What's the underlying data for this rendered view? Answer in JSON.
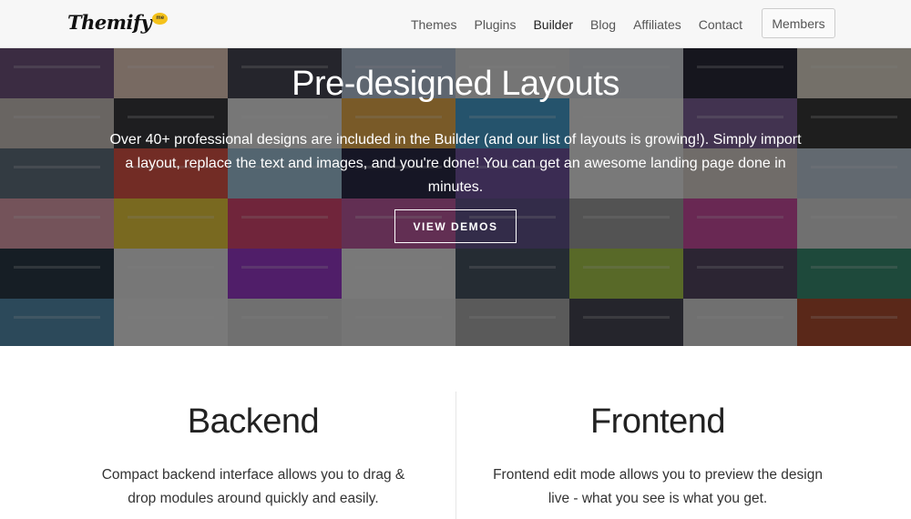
{
  "header": {
    "logo_text": "Themify",
    "logo_badge": "me",
    "nav": [
      "Themes",
      "Plugins",
      "Builder",
      "Blog",
      "Affiliates",
      "Contact"
    ],
    "active_nav": "Builder",
    "members_label": "Members"
  },
  "hero": {
    "title": "Pre-designed Layouts",
    "description": "Over 40+ professional designs are included in the Builder (and our list of layouts is growing!). Simply import a layout, replace the text and images, and you're done! You can get an awesome landing page done in minutes.",
    "button_label": "VIEW DEMOS",
    "mosaic_colors": [
      "#6a4a7a",
      "#f2d3c0",
      "#3a3a4a",
      "#b8c9e0",
      "#ececec",
      "#dfe4ea",
      "#1a1a2a",
      "#e8e0d0",
      "#d0c8c0",
      "#2a2a30",
      "#efefef",
      "#f4b040",
      "#3aa0d8",
      "#f4f4f4",
      "#7a5a9a",
      "#2a2a2a",
      "#5a6a7a",
      "#e44a3a",
      "#a0c8e0",
      "#1a1a3a",
      "#6a4aa0",
      "#f4f4f4",
      "#e0d8d0",
      "#c0d0e0",
      "#e8a0b0",
      "#f4d030",
      "#e03a6a",
      "#c050a0",
      "#5a4a8a",
      "#a0a0a0",
      "#d040a0",
      "#e0e0e0",
      "#1a2a3a",
      "#f0f0f0",
      "#9a2ad0",
      "#f4f4f4",
      "#3a4a5a",
      "#aad040",
      "#4a3a5a",
      "#2a8a6a",
      "#4a8ab0",
      "#f4f4f4",
      "#e0e0e0",
      "#eaeaea",
      "#b0b0b0",
      "#3a3a4a",
      "#e0e0e0",
      "#b04020"
    ]
  },
  "features": {
    "backend": {
      "title": "Backend",
      "text": "Compact backend interface allows you to drag & drop modules around quickly and easily."
    },
    "frontend": {
      "title": "Frontend",
      "text": "Frontend edit mode allows you to preview the design live - what you see is what you get."
    }
  }
}
